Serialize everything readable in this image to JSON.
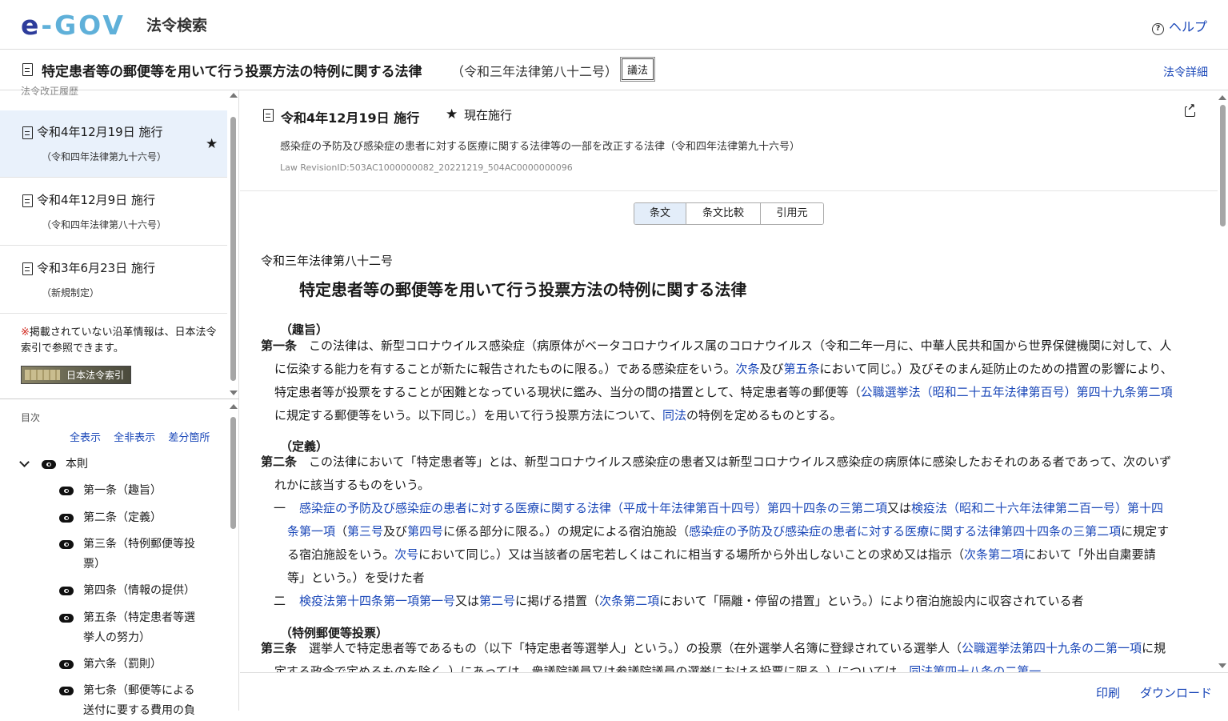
{
  "header": {
    "logo_text_e": "e",
    "logo_text_rest": "-GOV",
    "app_name": "法令検索",
    "help_label": "ヘルプ"
  },
  "law": {
    "title": "特定患者等の郵便等を用いて行う投票方法の特例に関する法律",
    "number": "（令和三年法律第八十二号）",
    "type_badge": "議法",
    "detail_link": "法令詳細"
  },
  "sidebar": {
    "history_label": "法令改正履歴",
    "revisions": [
      {
        "date": "令和4年12月19日 施行",
        "sub": "（令和四年法律第九十六号）",
        "current": true
      },
      {
        "date": "令和4年12月9日 施行",
        "sub": "（令和四年法律第八十六号）",
        "current": false
      },
      {
        "date": "令和3年6月23日 施行",
        "sub": "（新規制定）",
        "current": false
      }
    ],
    "note_mark": "※",
    "note_text": "掲載されていない沿革情報は、日本法令索引で参照できます。",
    "index_banner": "日本法令索引"
  },
  "toc": {
    "label": "目次",
    "controls": [
      "全表示",
      "全非表示",
      "差分箇所"
    ],
    "root": "本則",
    "items": [
      [
        "第一条（趣旨）"
      ],
      [
        "第二条（定義）"
      ],
      [
        "第三条（特例郵便等投",
        "票）"
      ],
      [
        "第四条（情報の提供）"
      ],
      [
        "第五条（特定患者等選",
        "挙人の努力）"
      ],
      [
        "第六条（罰則）"
      ],
      [
        "第七条（郵便等による",
        "送付に要する費用の負"
      ]
    ]
  },
  "revision_header": {
    "date": "令和4年12月19日 施行",
    "status": "現在施行",
    "amending_law": "感染症の予防及び感染症の患者に対する医療に関する法律等の一部を改正する法律（令和四年法律第九十六号）",
    "revision_id": "Law RevisionID:503AC1000000082_20221219_504AC0000000096"
  },
  "tabs": [
    "条文",
    "条文比較",
    "引用元"
  ],
  "body": {
    "law_number": "令和三年法律第八十二号",
    "law_title": "特定患者等の郵便等を用いて行う投票方法の特例に関する法律",
    "art1": {
      "caption": "（趣旨）",
      "title": "第一条",
      "t1": "この法律は、新型コロナウイルス感染症（病原体がベータコロナウイルス属のコロナウイルス（令和二年一月に、中華人民共和国から世界保健機関に対して、人に伝染する能力を有することが新たに報告されたものに限る。）である感染症をいう。",
      "l1": "次条",
      "t2": "及び",
      "l2": "第五条",
      "t3": "において同じ。）及びそのまん延防止のための措置の影響により、特定患者等が投票をすることが困難となっている現状に鑑み、当分の間の措置として、特定患者等の郵便等（",
      "l3": "公職選挙法（昭和二十五年法律第百号）第四十九条第二項",
      "t4": "に規定する郵便等をいう。以下同じ。）を用いて行う投票方法について、",
      "l4": "同法",
      "t5": "の特例を定めるものとする。"
    },
    "art2": {
      "caption": "（定義）",
      "title": "第二条",
      "t1": "この法律において「特定患者等」とは、新型コロナウイルス感染症の患者又は新型コロナウイルス感染症の病原体に感染したおそれのある者であって、次のいずれかに該当するものをいう。",
      "item1": {
        "num": "一",
        "l1": "感染症の予防及び感染症の患者に対する医療に関する法律（平成十年法律第百十四号）第四十四条の三第二項",
        "t1": "又は",
        "l2": "検疫法（昭和二十六年法律第二百一号）第十四条第一項",
        "t2": "（",
        "l3": "第三号",
        "t3": "及び",
        "l4": "第四号",
        "t4": "に係る部分に限る。）の規定による宿泊施設（",
        "l5": "感染症の予防及び感染症の患者に対する医療に関する法律第四十四条の三第二項",
        "t5": "に規定する宿泊施設をいう。",
        "l6": "次号",
        "t6": "において同じ。）又は当該者の居宅若しくはこれに相当する場所から外出しないことの求め又は指示（",
        "l7": "次条第二項",
        "t7": "において「外出自粛要請等」という。）を受けた者"
      },
      "item2": {
        "num": "二",
        "l1": "検疫法第十四条第一項第一号",
        "t1": "又は",
        "l2": "第二号",
        "t2": "に掲げる措置（",
        "l3": "次条第二項",
        "t3": "において「隔離・停留の措置」という。）により宿泊施設内に収容されている者"
      }
    },
    "art3": {
      "caption": "（特例郵便等投票）",
      "title": "第三条",
      "t1": "選挙人で特定患者等であるもの（以下「特定患者等選挙人」という。）の投票（在外選挙人名簿に登録されている選挙人（",
      "l1": "公職選挙法第四十九条の二第一項",
      "t2": "に規定する政令で定めるものを除く。）にあっては、衆議院議員又は参議院議員の選挙における投票に限る。）については、",
      "l2": "同法第四十八条の二第一"
    }
  },
  "footer": {
    "print": "印刷",
    "download": "ダウンロード"
  }
}
